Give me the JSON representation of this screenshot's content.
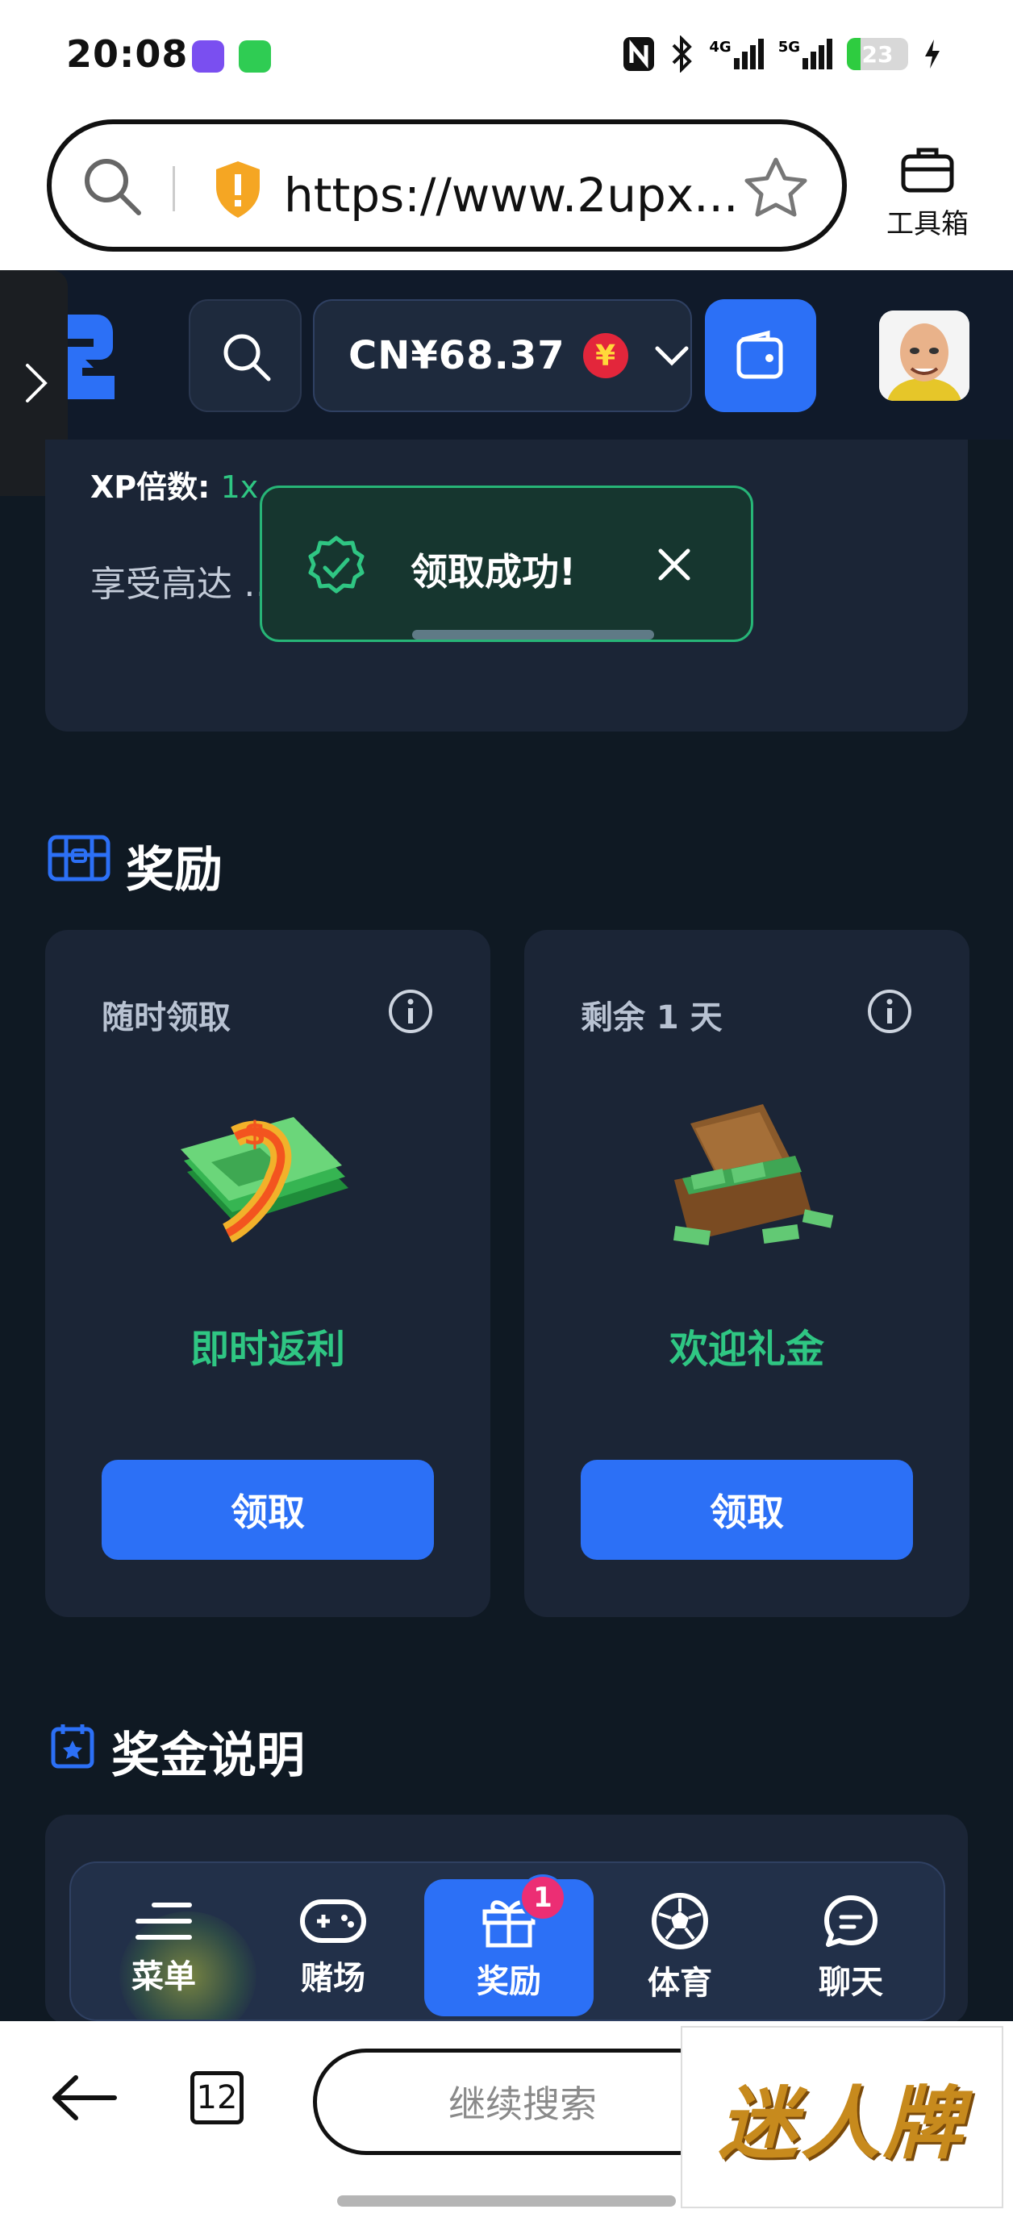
{
  "status_bar": {
    "time": "20:08",
    "network_1": "4G",
    "network_2": "5G",
    "battery": "23",
    "battery_level": 0.23
  },
  "browser": {
    "url": "https://www.2upx...",
    "toolbox_label": "工具箱",
    "tab_count": "12",
    "search_placeholder": "继续搜索"
  },
  "header": {
    "balance": "CN¥68.37",
    "currency_symbol": "¥"
  },
  "xp": {
    "label": "XP倍数:",
    "multiplier": "1x",
    "description": "享受高达 … 红利和促销优惠。"
  },
  "toast": {
    "message": "领取成功!"
  },
  "rewards_section": {
    "title": "奖励",
    "cards": [
      {
        "timing": "随时领取",
        "name": "即时返利",
        "button": "领取"
      },
      {
        "timing": "剩余 1 天",
        "name": "欢迎礼金",
        "button": "领取"
      }
    ]
  },
  "bonus_section": {
    "title": "奖金说明"
  },
  "bottom_nav": {
    "items": [
      {
        "label": "菜单",
        "icon": "menu-icon"
      },
      {
        "label": "赌场",
        "icon": "gamepad-icon"
      },
      {
        "label": "奖励",
        "icon": "gift-icon",
        "badge": "1",
        "active": true
      },
      {
        "label": "体育",
        "icon": "soccer-ball-icon"
      },
      {
        "label": "聊天",
        "icon": "chat-icon"
      }
    ]
  },
  "ad": {
    "text": "迷人牌"
  },
  "colors": {
    "accent_blue": "#2c70f6",
    "success_green": "#2fc683",
    "page_bg": "#0f1923",
    "card_bg": "#1b2536"
  }
}
